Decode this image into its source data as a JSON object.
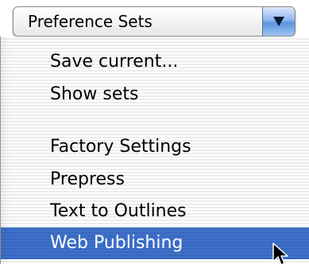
{
  "popup": {
    "label": "Preference Sets",
    "arrow_icon": "chevron-down-icon"
  },
  "menu": {
    "items": [
      {
        "label": "Save current...",
        "selected": false
      },
      {
        "label": "Show sets",
        "selected": false
      },
      {
        "label": "Factory Settings",
        "selected": false
      },
      {
        "label": "Prepress",
        "selected": false
      },
      {
        "label": "Text to Outlines",
        "selected": false
      },
      {
        "label": "Web Publishing",
        "selected": true
      }
    ]
  },
  "colors": {
    "selection": "#3d6fc6",
    "arrow_button": "#5d93e0"
  },
  "cursor": {
    "icon": "arrow-pointer-icon"
  }
}
